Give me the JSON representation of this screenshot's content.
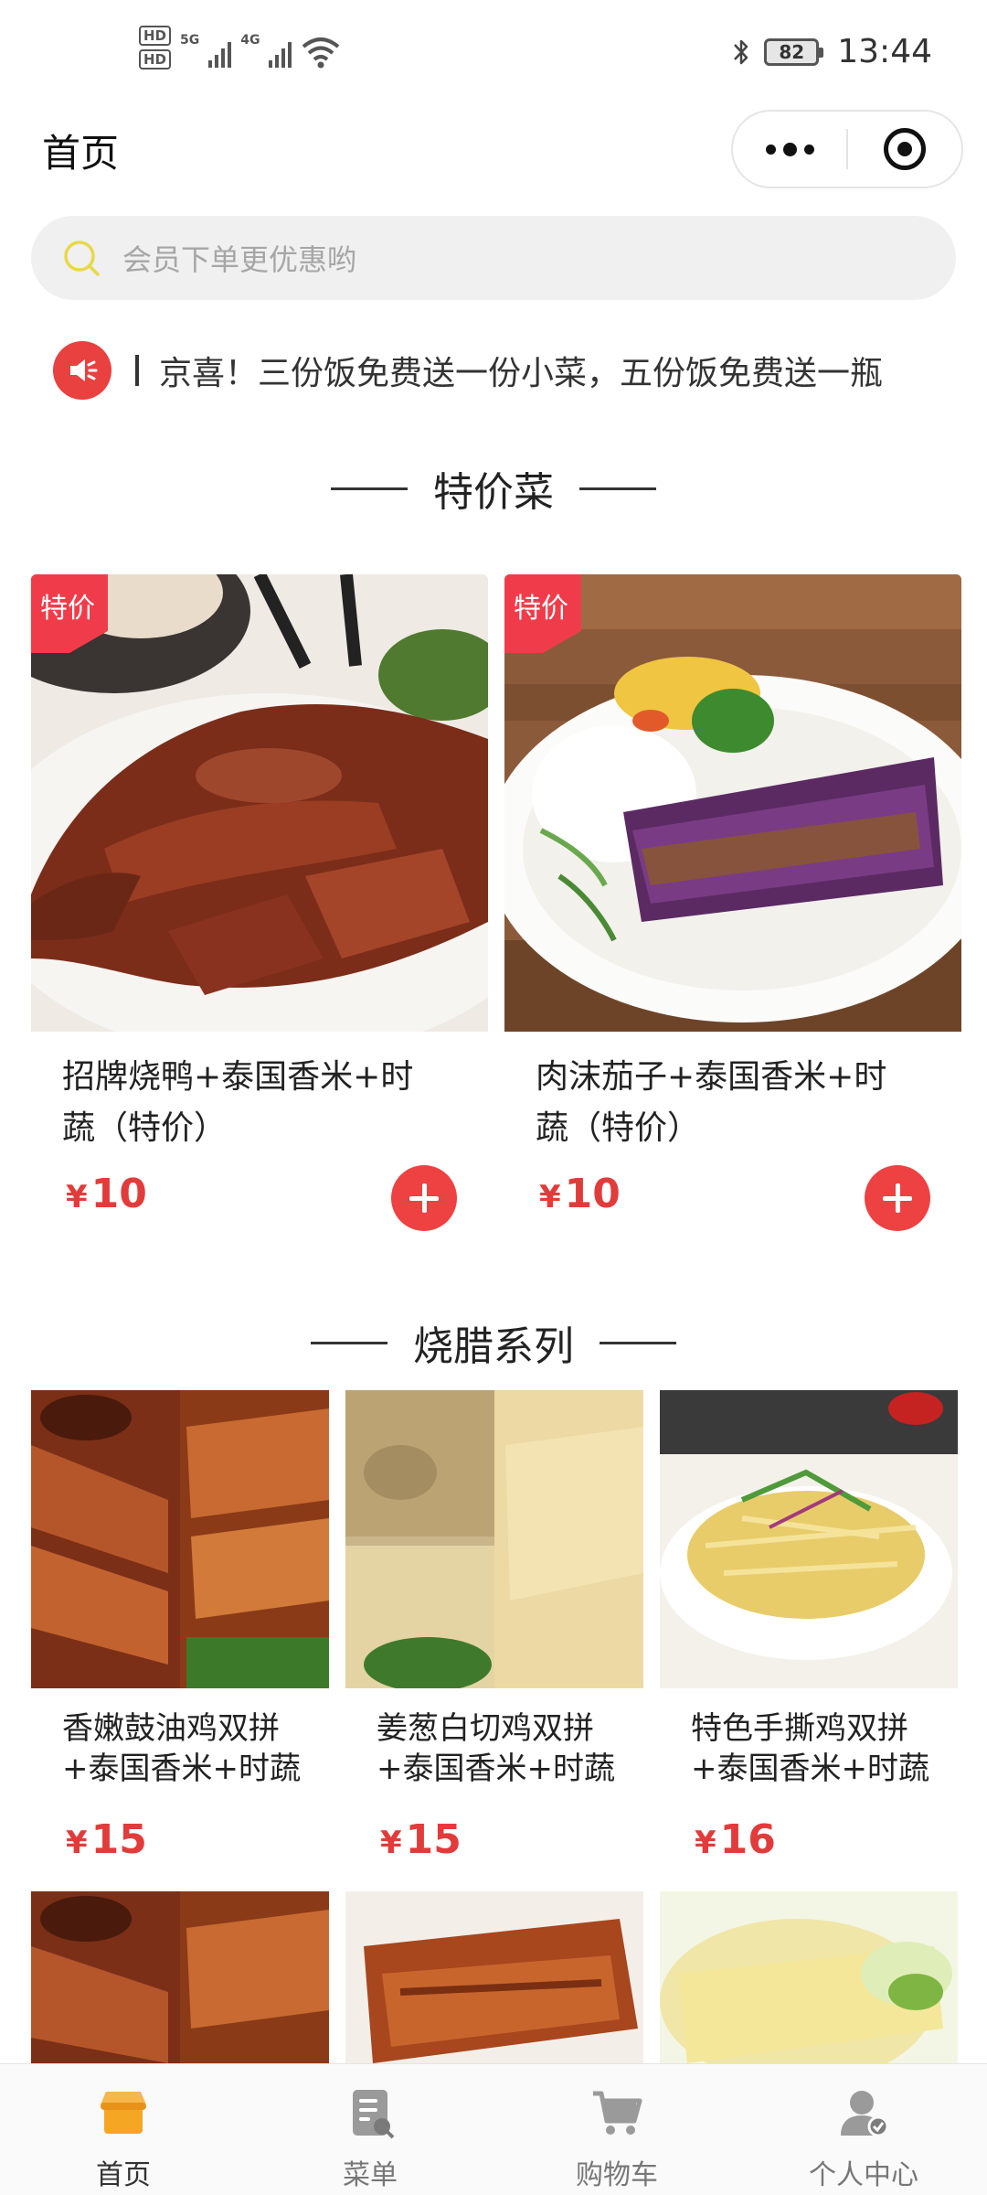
{
  "status_bar": {
    "hd1": "HD",
    "hd2": "HD",
    "net1": "5G",
    "net2": "4G",
    "battery": "82",
    "time": "13:44"
  },
  "header": {
    "title": "首页"
  },
  "search": {
    "placeholder": "会员下单更优惠哟"
  },
  "notice": {
    "text": "京喜！三份饭免费送一份小菜，五份饭免费送一瓶"
  },
  "sections": {
    "special": "特价菜",
    "roast": "烧腊系列"
  },
  "special_items": [
    {
      "tag": "特价",
      "name": "招牌烧鸭+泰国香米+时蔬（特价）",
      "currency": "¥",
      "price": "10"
    },
    {
      "tag": "特价",
      "name": "肉沫茄子+泰国香米+时蔬（特价）",
      "currency": "¥",
      "price": "10"
    }
  ],
  "roast_items": [
    {
      "name": "香嫩鼓油鸡双拼+泰国香米+时蔬",
      "currency": "¥",
      "price": "15"
    },
    {
      "name": "姜葱白切鸡双拼+泰国香米+时蔬",
      "currency": "¥",
      "price": "15"
    },
    {
      "name": "特色手撕鸡双拼+泰国香米+时蔬",
      "currency": "¥",
      "price": "16"
    }
  ],
  "tabbar": [
    {
      "label": "首页",
      "icon": "store-icon"
    },
    {
      "label": "菜单",
      "icon": "menu-icon"
    },
    {
      "label": "购物车",
      "icon": "cart-icon"
    },
    {
      "label": "个人中心",
      "icon": "user-icon"
    }
  ],
  "colors": {
    "accent": "#E94040",
    "tab_active": "#F5A623",
    "tab_inactive": "#999999",
    "search_icon": "#E8D84A"
  }
}
